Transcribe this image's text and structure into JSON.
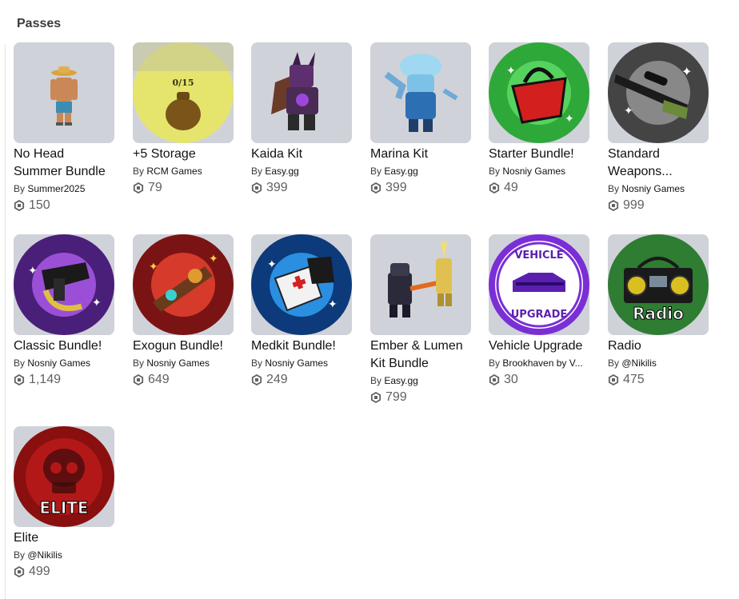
{
  "section": {
    "title": "Passes"
  },
  "by_label": "By",
  "passes": [
    {
      "name": "No Head Summer Bundle",
      "creator": "Summer2025",
      "price": "150",
      "icon": "straw-hat-avatar-icon"
    },
    {
      "name": "+5 Storage",
      "creator": "RCM Games",
      "price": "79",
      "icon": "storage-pot-icon",
      "thumb_text": "0/15"
    },
    {
      "name": "Kaida Kit",
      "creator": "Easy.gg",
      "price": "399",
      "icon": "kaida-character-icon"
    },
    {
      "name": "Marina Kit",
      "creator": "Easy.gg",
      "price": "399",
      "icon": "jellyfish-character-icon"
    },
    {
      "name": "Starter Bundle!",
      "creator": "Nosniy Games",
      "price": "49",
      "icon": "shopping-basket-icon"
    },
    {
      "name": "Standard Weapons...",
      "creator": "Nosniy Games",
      "price": "999",
      "icon": "rifle-icon"
    },
    {
      "name": "Classic Bundle!",
      "creator": "Nosniy Games",
      "price": "1,149",
      "icon": "classic-weapons-icon"
    },
    {
      "name": "Exogun Bundle!",
      "creator": "Nosniy Games",
      "price": "649",
      "icon": "exogun-icon"
    },
    {
      "name": "Medkit Bundle!",
      "creator": "Nosniy Games",
      "price": "249",
      "icon": "medkit-icon"
    },
    {
      "name": "Ember & Lumen Kit Bundle",
      "creator": "Easy.gg",
      "price": "799",
      "icon": "ember-lumen-characters-icon"
    },
    {
      "name": "Vehicle Upgrade",
      "creator": "Brookhaven by V...",
      "price": "30",
      "icon": "vehicle-upgrade-badge-icon",
      "thumb_text_top": "VEHICLE",
      "thumb_text_bottom": "UPGRADE"
    },
    {
      "name": "Radio",
      "creator": "@Nikilis",
      "price": "475",
      "icon": "radio-boombox-icon",
      "thumb_text": "Radio"
    },
    {
      "name": "Elite",
      "creator": "@Nikilis",
      "price": "499",
      "icon": "elite-skull-icon",
      "thumb_text": "ELITE"
    }
  ],
  "colors": {
    "thumb_bg": "#d0d2d9",
    "price_text": "#606162"
  }
}
